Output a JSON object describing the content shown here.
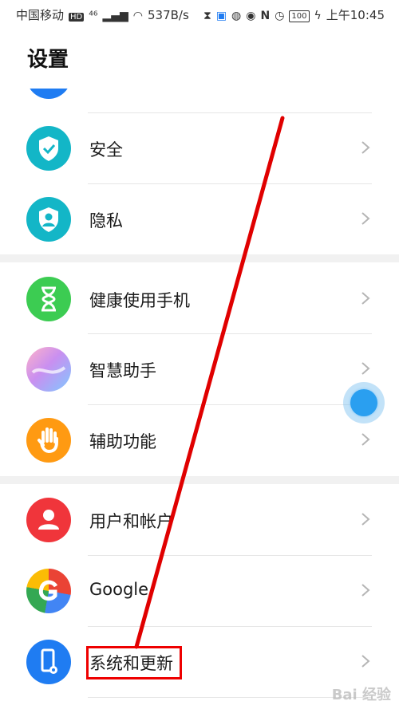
{
  "status_bar": {
    "carrier": "中国移动",
    "hd": "HD",
    "net": "⁴⁶",
    "speed": "537B/s",
    "battery": "100",
    "time": "上午10:45"
  },
  "title": "设置",
  "settings": [
    {
      "label": "安全",
      "icon": "shield-icon",
      "color": "#13b6c7"
    },
    {
      "label": "隐私",
      "icon": "privacy-icon",
      "color": "#13b6c7"
    },
    {
      "label": "健康使用手机",
      "icon": "hourglass-icon",
      "color": "#3ccc52"
    },
    {
      "label": "智慧助手",
      "icon": "assistant-icon",
      "color": "#c98ff0"
    },
    {
      "label": "辅助功能",
      "icon": "hand-icon",
      "color": "#ff9a12"
    },
    {
      "label": "用户和帐户",
      "icon": "user-icon",
      "color": "#f0353b"
    },
    {
      "label": "Google",
      "icon": "google-icon",
      "color": "#4285f4"
    },
    {
      "label": "系统和更新",
      "icon": "phone-settings-icon",
      "color": "#1f7cf2"
    }
  ],
  "colors": {
    "annotation": "#e00000",
    "floating_ball": "#2a9ff0"
  },
  "watermark": "Bai 经验"
}
